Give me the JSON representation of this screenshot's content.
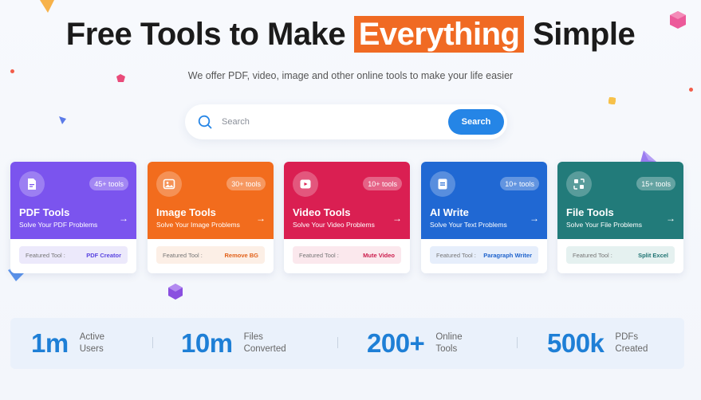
{
  "hero": {
    "title_before": "Free Tools to Make ",
    "title_highlight": "Everything",
    "title_after": " Simple",
    "subtitle": "We offer PDF, video, image and other online tools to make your life easier"
  },
  "search": {
    "placeholder": "Search",
    "button_label": "Search"
  },
  "cards": [
    {
      "title": "PDF Tools",
      "desc": "Solve Your PDF Problems",
      "badge": "45+ tools",
      "featured_label": "Featured Tool :",
      "featured_tool": "PDF Creator",
      "color": "#7b54ee",
      "feat_bg": "#ece9fb",
      "feat_color": "#5a45e0",
      "icon": "pdf-icon"
    },
    {
      "title": "Image Tools",
      "desc": "Solve Your Image Problems",
      "badge": "30+ tools",
      "featured_label": "Featured Tool :",
      "featured_tool": "Remove BG",
      "color": "#f26c1d",
      "feat_bg": "#fcefe6",
      "feat_color": "#e2621a",
      "icon": "image-icon"
    },
    {
      "title": "Video Tools",
      "desc": "Solve Your Video Problems",
      "badge": "10+ tools",
      "featured_label": "Featured Tool :",
      "featured_tool": "Mute Video",
      "color": "#da1f52",
      "feat_bg": "#fbe8ed",
      "feat_color": "#cc1d4d",
      "icon": "video-icon"
    },
    {
      "title": "AI Write",
      "desc": "Solve Your Text Problems",
      "badge": "10+ tools",
      "featured_label": "Featured Tool :",
      "featured_tool": "Paragraph Writer",
      "color": "#2068d3",
      "feat_bg": "#e6eefb",
      "feat_color": "#1f63cc",
      "icon": "ai-write-icon"
    },
    {
      "title": "File Tools",
      "desc": "Solve Your File Problems",
      "badge": "15+ tools",
      "featured_label": "Featured Tool :",
      "featured_tool": "Split Excel",
      "color": "#227b7a",
      "feat_bg": "#e5f1f0",
      "feat_color": "#1f7473",
      "icon": "file-icon"
    }
  ],
  "stats": [
    {
      "num": "1m",
      "label_line1": "Active",
      "label_line2": "Users"
    },
    {
      "num": "10m",
      "label_line1": "Files",
      "label_line2": "Converted"
    },
    {
      "num": "200+",
      "label_line1": "Online",
      "label_line2": "Tools"
    },
    {
      "num": "500k",
      "label_line1": "PDFs",
      "label_line2": "Created"
    }
  ],
  "colors": {
    "accent": "#f06a23",
    "primary": "#2585e6",
    "stat_number": "#1e7fd6"
  }
}
